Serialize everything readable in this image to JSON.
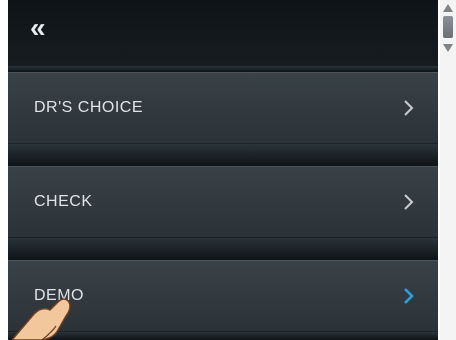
{
  "header": {
    "back_icon": "«",
    "back_icon_name": "double-chevron-left-icon"
  },
  "menu": {
    "items": [
      {
        "label": "DR'S CHOICE",
        "chevron_color": "#c8cdd0",
        "active": false
      },
      {
        "label": "CHECK",
        "chevron_color": "#c8cdd0",
        "active": false
      },
      {
        "label": "DEMO",
        "chevron_color": "#2aa3e6",
        "active": true
      }
    ]
  },
  "colors": {
    "panel": "#1b2227",
    "item_text": "#dfe4e6",
    "accent": "#2aa3e6"
  }
}
